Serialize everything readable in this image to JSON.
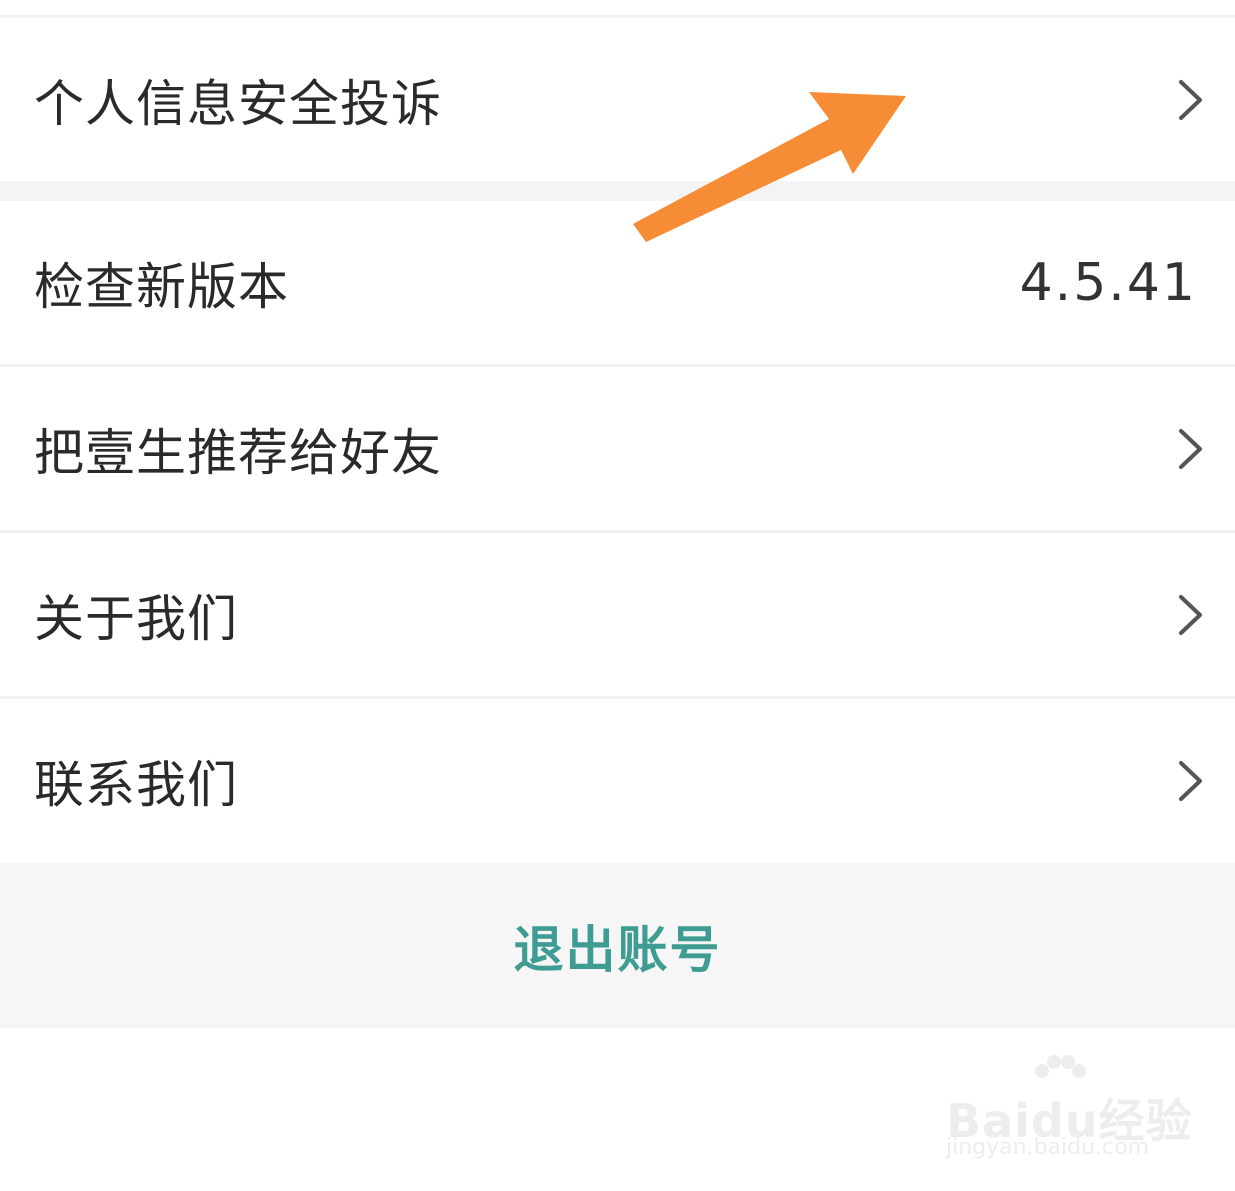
{
  "settings": {
    "items": [
      {
        "label": "个人信息安全投诉",
        "trailing": "chevron-right-icon"
      },
      {
        "label": "检查新版本",
        "value": "4.5.41"
      },
      {
        "label": "把壹生推荐给好友",
        "trailing": "chevron-right-icon"
      },
      {
        "label": "关于我们",
        "trailing": "chevron-right-icon"
      },
      {
        "label": "联系我们",
        "trailing": "chevron-right-icon"
      }
    ]
  },
  "logout": {
    "label": "退出账号"
  },
  "annotation": {
    "icon": "arrow-icon",
    "color": "#f78c36"
  },
  "watermark": {
    "brand": "Baidu经验",
    "url": "jingyan.baidu.com"
  },
  "colors": {
    "accent": "#3e9c93",
    "background_gap": "#f4f4f4",
    "text": "#2a2a2a"
  }
}
